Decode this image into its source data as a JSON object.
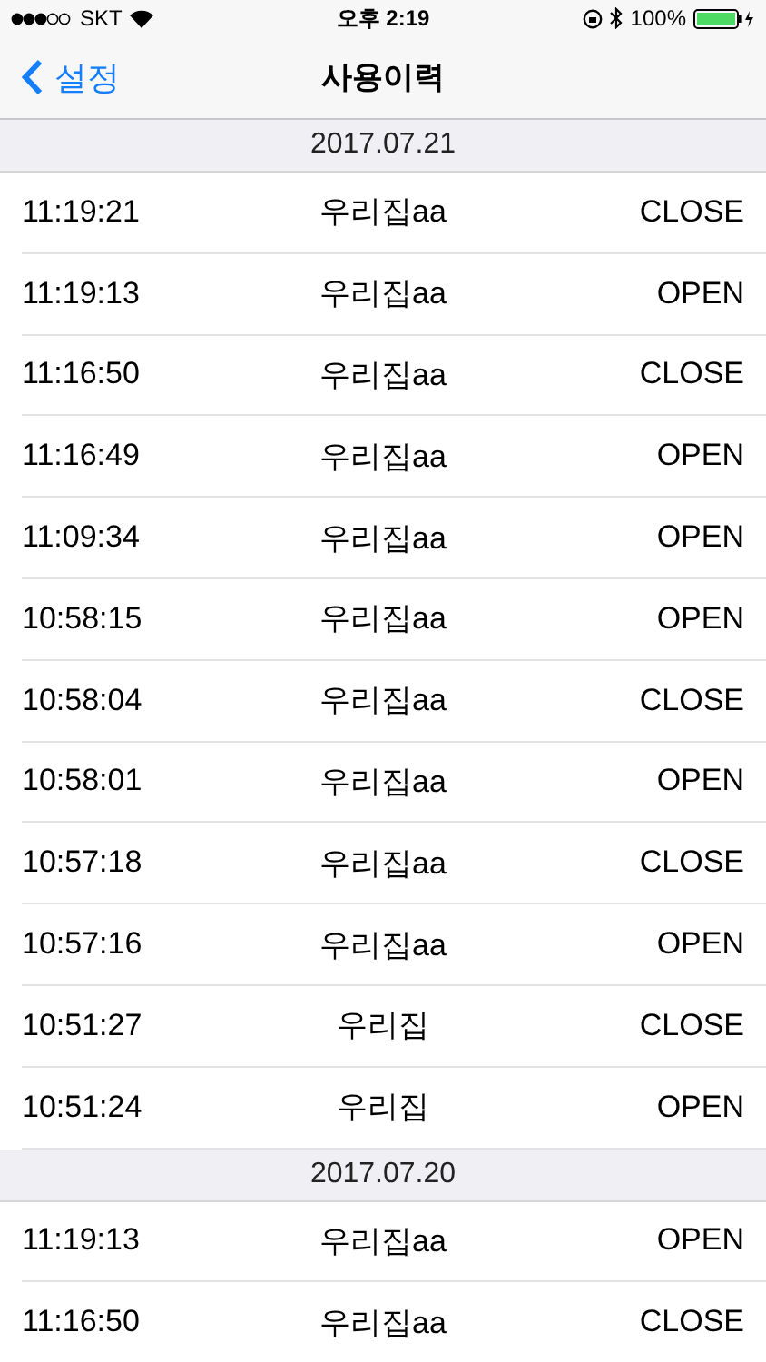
{
  "status_bar": {
    "carrier": "SKT",
    "time": "오후 2:19",
    "battery": "100%"
  },
  "nav": {
    "back": "설정",
    "title": "사용이력"
  },
  "sections": [
    {
      "date": "2017.07.21",
      "rows": [
        {
          "time": "11:19:21",
          "place": "우리집aa",
          "action": "CLOSE"
        },
        {
          "time": "11:19:13",
          "place": "우리집aa",
          "action": "OPEN"
        },
        {
          "time": "11:16:50",
          "place": "우리집aa",
          "action": "CLOSE"
        },
        {
          "time": "11:16:49",
          "place": "우리집aa",
          "action": "OPEN"
        },
        {
          "time": "11:09:34",
          "place": "우리집aa",
          "action": "OPEN"
        },
        {
          "time": "10:58:15",
          "place": "우리집aa",
          "action": "OPEN"
        },
        {
          "time": "10:58:04",
          "place": "우리집aa",
          "action": "CLOSE"
        },
        {
          "time": "10:58:01",
          "place": "우리집aa",
          "action": "OPEN"
        },
        {
          "time": "10:57:18",
          "place": "우리집aa",
          "action": "CLOSE"
        },
        {
          "time": "10:57:16",
          "place": "우리집aa",
          "action": "OPEN"
        },
        {
          "time": "10:51:27",
          "place": "우리집",
          "action": "CLOSE"
        },
        {
          "time": "10:51:24",
          "place": "우리집",
          "action": "OPEN"
        }
      ]
    },
    {
      "date": "2017.07.20",
      "rows": [
        {
          "time": "11:19:13",
          "place": "우리집aa",
          "action": "OPEN"
        },
        {
          "time": "11:16:50",
          "place": "우리집aa",
          "action": "CLOSE"
        }
      ]
    }
  ]
}
